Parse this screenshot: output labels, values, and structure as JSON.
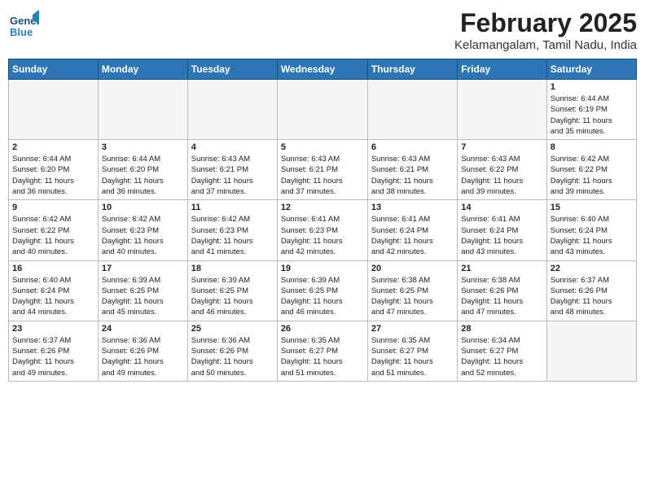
{
  "header": {
    "logo_line1": "General",
    "logo_line2": "Blue",
    "month_title": "February 2025",
    "location": "Kelamangalam, Tamil Nadu, India"
  },
  "weekdays": [
    "Sunday",
    "Monday",
    "Tuesday",
    "Wednesday",
    "Thursday",
    "Friday",
    "Saturday"
  ],
  "weeks": [
    [
      {
        "day": "",
        "info": ""
      },
      {
        "day": "",
        "info": ""
      },
      {
        "day": "",
        "info": ""
      },
      {
        "day": "",
        "info": ""
      },
      {
        "day": "",
        "info": ""
      },
      {
        "day": "",
        "info": ""
      },
      {
        "day": "1",
        "info": "Sunrise: 6:44 AM\nSunset: 6:19 PM\nDaylight: 11 hours\nand 35 minutes."
      }
    ],
    [
      {
        "day": "2",
        "info": "Sunrise: 6:44 AM\nSunset: 6:20 PM\nDaylight: 11 hours\nand 36 minutes."
      },
      {
        "day": "3",
        "info": "Sunrise: 6:44 AM\nSunset: 6:20 PM\nDaylight: 11 hours\nand 36 minutes."
      },
      {
        "day": "4",
        "info": "Sunrise: 6:43 AM\nSunset: 6:21 PM\nDaylight: 11 hours\nand 37 minutes."
      },
      {
        "day": "5",
        "info": "Sunrise: 6:43 AM\nSunset: 6:21 PM\nDaylight: 11 hours\nand 37 minutes."
      },
      {
        "day": "6",
        "info": "Sunrise: 6:43 AM\nSunset: 6:21 PM\nDaylight: 11 hours\nand 38 minutes."
      },
      {
        "day": "7",
        "info": "Sunrise: 6:43 AM\nSunset: 6:22 PM\nDaylight: 11 hours\nand 39 minutes."
      },
      {
        "day": "8",
        "info": "Sunrise: 6:42 AM\nSunset: 6:22 PM\nDaylight: 11 hours\nand 39 minutes."
      }
    ],
    [
      {
        "day": "9",
        "info": "Sunrise: 6:42 AM\nSunset: 6:22 PM\nDaylight: 11 hours\nand 40 minutes."
      },
      {
        "day": "10",
        "info": "Sunrise: 6:42 AM\nSunset: 6:23 PM\nDaylight: 11 hours\nand 40 minutes."
      },
      {
        "day": "11",
        "info": "Sunrise: 6:42 AM\nSunset: 6:23 PM\nDaylight: 11 hours\nand 41 minutes."
      },
      {
        "day": "12",
        "info": "Sunrise: 6:41 AM\nSunset: 6:23 PM\nDaylight: 11 hours\nand 42 minutes."
      },
      {
        "day": "13",
        "info": "Sunrise: 6:41 AM\nSunset: 6:24 PM\nDaylight: 11 hours\nand 42 minutes."
      },
      {
        "day": "14",
        "info": "Sunrise: 6:41 AM\nSunset: 6:24 PM\nDaylight: 11 hours\nand 43 minutes."
      },
      {
        "day": "15",
        "info": "Sunrise: 6:40 AM\nSunset: 6:24 PM\nDaylight: 11 hours\nand 43 minutes."
      }
    ],
    [
      {
        "day": "16",
        "info": "Sunrise: 6:40 AM\nSunset: 6:24 PM\nDaylight: 11 hours\nand 44 minutes."
      },
      {
        "day": "17",
        "info": "Sunrise: 6:39 AM\nSunset: 6:25 PM\nDaylight: 11 hours\nand 45 minutes."
      },
      {
        "day": "18",
        "info": "Sunrise: 6:39 AM\nSunset: 6:25 PM\nDaylight: 11 hours\nand 46 minutes."
      },
      {
        "day": "19",
        "info": "Sunrise: 6:39 AM\nSunset: 6:25 PM\nDaylight: 11 hours\nand 46 minutes."
      },
      {
        "day": "20",
        "info": "Sunrise: 6:38 AM\nSunset: 6:25 PM\nDaylight: 11 hours\nand 47 minutes."
      },
      {
        "day": "21",
        "info": "Sunrise: 6:38 AM\nSunset: 6:26 PM\nDaylight: 11 hours\nand 47 minutes."
      },
      {
        "day": "22",
        "info": "Sunrise: 6:37 AM\nSunset: 6:26 PM\nDaylight: 11 hours\nand 48 minutes."
      }
    ],
    [
      {
        "day": "23",
        "info": "Sunrise: 6:37 AM\nSunset: 6:26 PM\nDaylight: 11 hours\nand 49 minutes."
      },
      {
        "day": "24",
        "info": "Sunrise: 6:36 AM\nSunset: 6:26 PM\nDaylight: 11 hours\nand 49 minutes."
      },
      {
        "day": "25",
        "info": "Sunrise: 6:36 AM\nSunset: 6:26 PM\nDaylight: 11 hours\nand 50 minutes."
      },
      {
        "day": "26",
        "info": "Sunrise: 6:35 AM\nSunset: 6:27 PM\nDaylight: 11 hours\nand 51 minutes."
      },
      {
        "day": "27",
        "info": "Sunrise: 6:35 AM\nSunset: 6:27 PM\nDaylight: 11 hours\nand 51 minutes."
      },
      {
        "day": "28",
        "info": "Sunrise: 6:34 AM\nSunset: 6:27 PM\nDaylight: 11 hours\nand 52 minutes."
      },
      {
        "day": "",
        "info": ""
      }
    ]
  ]
}
